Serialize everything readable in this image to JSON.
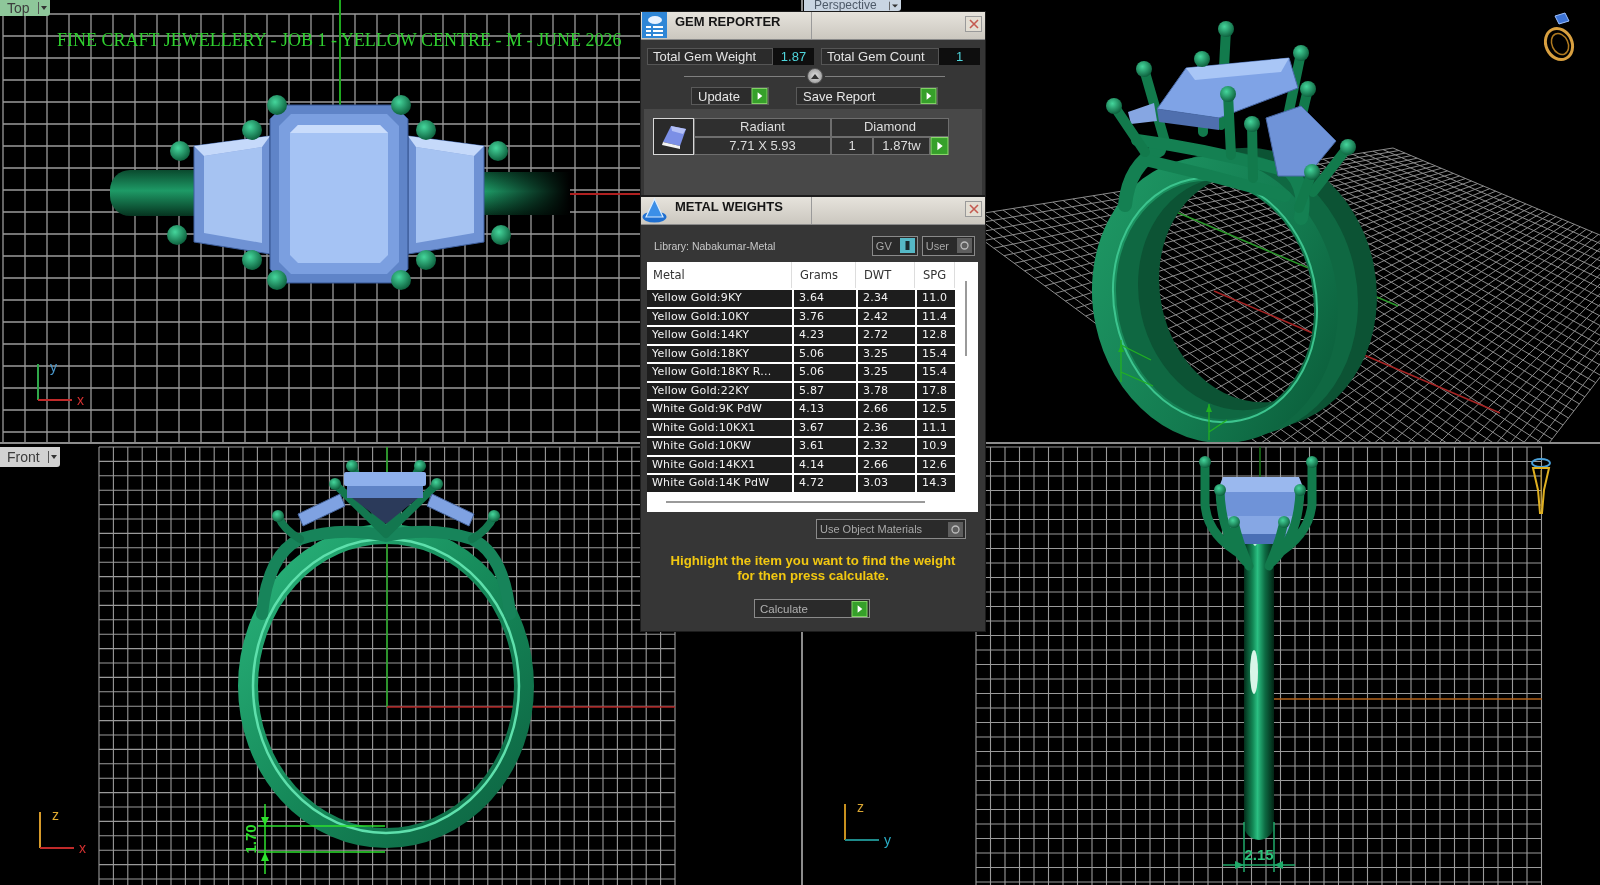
{
  "viewports": [
    {
      "kind": "top",
      "tab": {
        "label": "Top",
        "selected": true
      },
      "title": "FINE CRAFT JEWELLERY - JOB 1 - YELLOW CENTRE - M - JUNE 2026",
      "axes": [
        "y",
        "x"
      ]
    },
    {
      "kind": "perspective",
      "tab": {
        "label": "Perspective",
        "selected": false
      }
    },
    {
      "kind": "front",
      "tab": {
        "label": "Front",
        "selected": false
      },
      "axes": [
        "z",
        "x"
      ],
      "dimension": "1.70"
    },
    {
      "kind": "right",
      "axes": [
        "z",
        "y"
      ],
      "dimension": "2.15"
    }
  ],
  "gem_reporter": {
    "title": "GEM REPORTER",
    "totals": [
      {
        "label": "Total Gem Weight",
        "value": "1.87"
      },
      {
        "label": "Total Gem Count",
        "value": "1"
      }
    ],
    "buttons": [
      "Update",
      "Save Report"
    ],
    "gems": [
      {
        "shape": "Radiant",
        "stone": "Diamond",
        "size": "7.71 X 5.93",
        "count": "1",
        "weight": "1.87tw"
      }
    ]
  },
  "metal_weights": {
    "title": "METAL WEIGHTS",
    "library": "Library: Nabakumar-Metal",
    "toggles": [
      {
        "label": "GV",
        "on": true
      },
      {
        "label": "User",
        "on": false
      }
    ],
    "table": {
      "columns": [
        "Metal",
        "Grams",
        "DWT",
        "SPG"
      ],
      "rows": [
        [
          "Yellow Gold:9KY",
          "3.64",
          "2.34",
          "11.0"
        ],
        [
          "Yellow Gold:10KY",
          "3.76",
          "2.42",
          "11.4"
        ],
        [
          "Yellow Gold:14KY",
          "4.23",
          "2.72",
          "12.8"
        ],
        [
          "Yellow Gold:18KY",
          "5.06",
          "3.25",
          "15.4"
        ],
        [
          "Yellow Gold:18KY R...",
          "5.06",
          "3.25",
          "15.4"
        ],
        [
          "Yellow Gold:22KY",
          "5.87",
          "3.78",
          "17.8"
        ],
        [
          "White Gold:9K PdW",
          "4.13",
          "2.66",
          "12.5"
        ],
        [
          "White Gold:10KX1",
          "3.67",
          "2.36",
          "11.1"
        ],
        [
          "White Gold:10KW",
          "3.61",
          "2.32",
          "10.9"
        ],
        [
          "White Gold:14KX1",
          "4.14",
          "2.66",
          "12.6"
        ],
        [
          "White Gold:14K PdW",
          "4.72",
          "3.03",
          "14.3"
        ]
      ]
    },
    "object_materials": {
      "label": "Use Object Materials",
      "on": false
    },
    "hint": "Highlight the item you want to find the weight for then press calculate.",
    "button": "Calculate"
  }
}
